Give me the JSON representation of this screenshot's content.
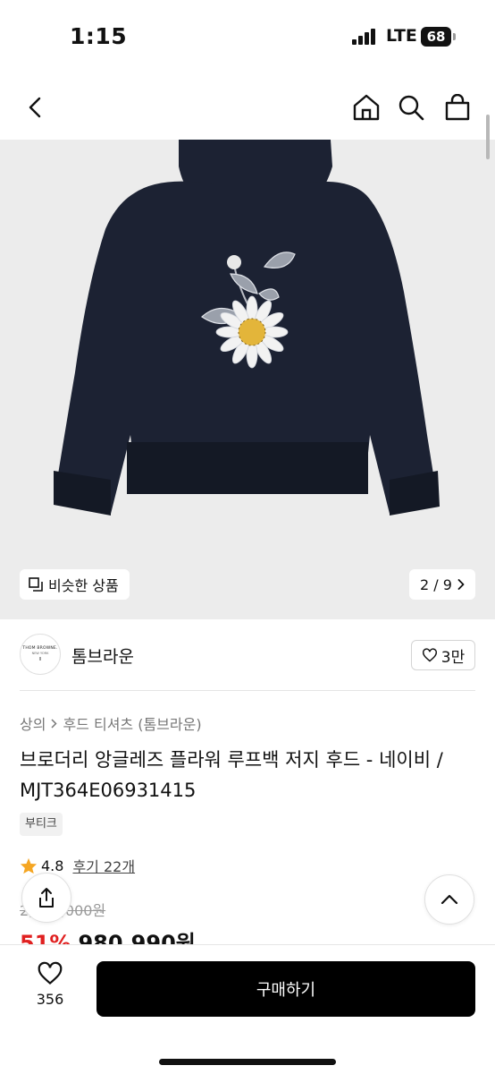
{
  "status": {
    "time": "1:15",
    "network": "LTE",
    "battery": "68"
  },
  "gallery": {
    "similar_label": "비슷한 상품",
    "page": "2 / 9"
  },
  "brand": {
    "name": "톰브라운",
    "logo_line1": "THOM BROWNE.",
    "logo_line2": "NEW YORK",
    "logo_line3": "II",
    "likes": "3만"
  },
  "breadcrumb": {
    "level1": "상의",
    "level2": "후드 티셔츠 (톰브라운)"
  },
  "product": {
    "title": "브로더리 앙글레즈 플라워 루프백 저지 후드 - 네이비 / MJT364E06931415",
    "tag": "부티크",
    "rating": "4.8",
    "review_label": "후기 22개",
    "original_price": "2,000,000원",
    "discount": "51%",
    "sale_price": "980,990원"
  },
  "bottom": {
    "wish_count": "356",
    "buy_label": "구매하기"
  },
  "colors": {
    "sale_red": "#e02020",
    "star": "#f5a623",
    "buy_bg": "#000000",
    "navy": "#1c2233"
  },
  "icons": {
    "nav": [
      "back-icon",
      "home-icon",
      "search-icon",
      "shopping-bag-icon"
    ],
    "others": [
      "similar-icon",
      "chevron-right-icon",
      "heart-icon",
      "star-icon",
      "share-icon",
      "chevron-up-icon"
    ]
  }
}
